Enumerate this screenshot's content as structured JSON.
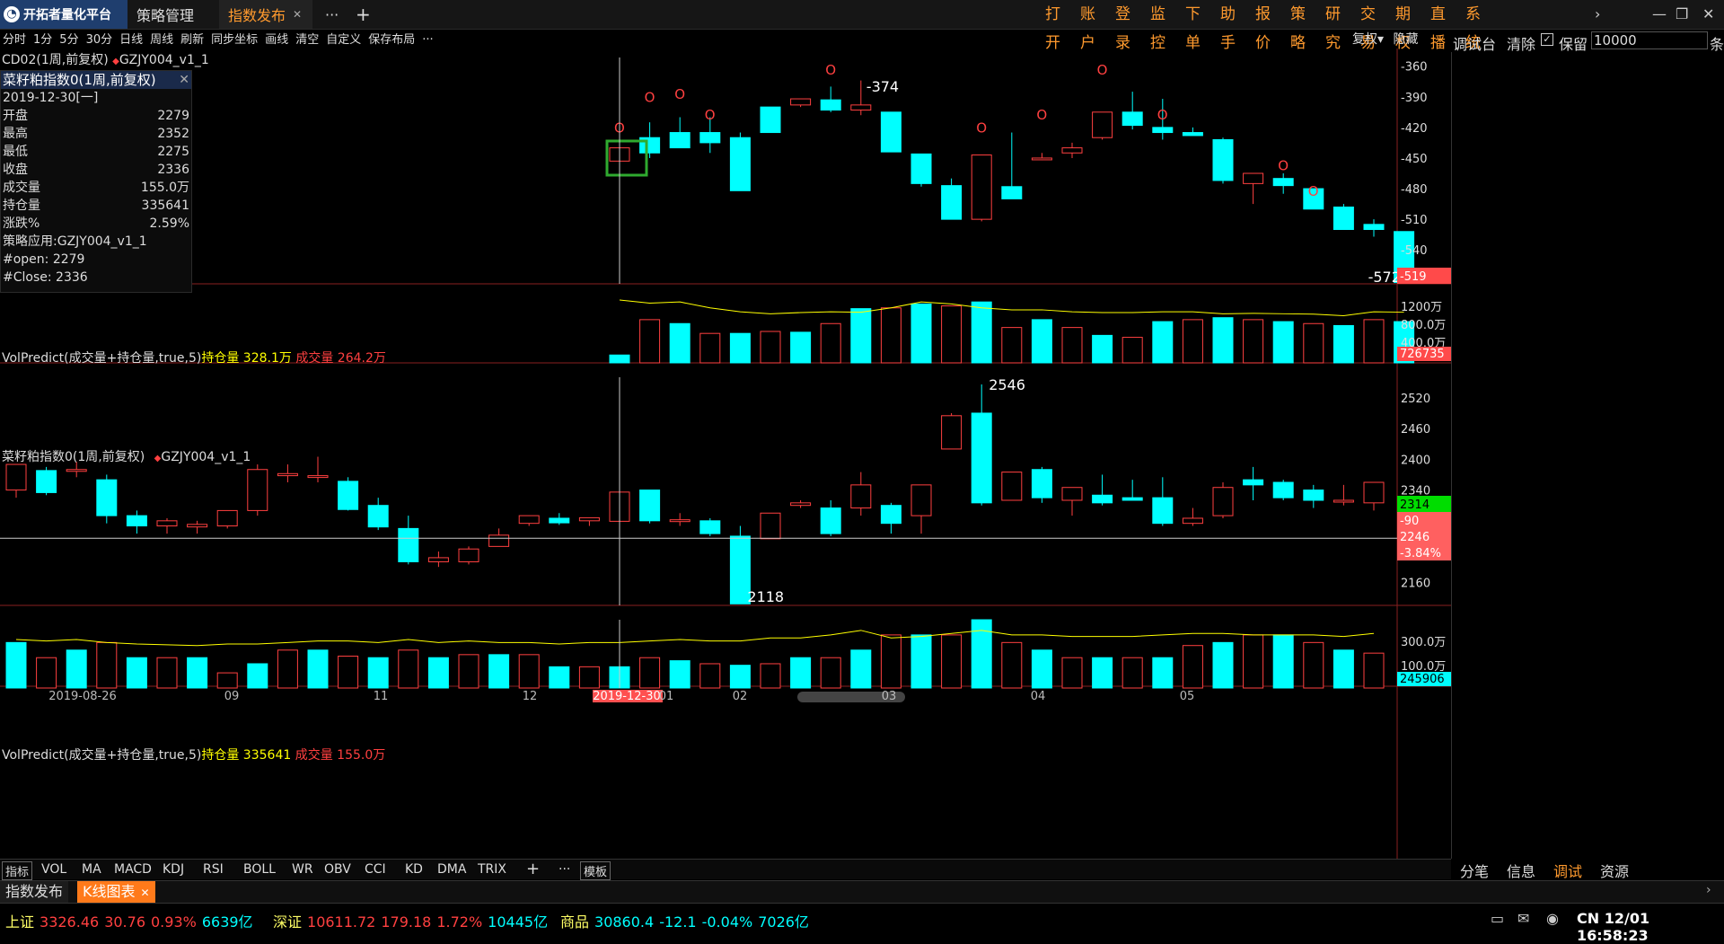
{
  "app": {
    "logo": "开拓者量化平台",
    "tabs": [
      {
        "label": "策略管理"
      },
      {
        "label": "指数发布"
      }
    ],
    "more": "···",
    "add": "+",
    "menus": [
      "打开",
      "账户",
      "登录",
      "监控",
      "下单",
      "助手",
      "报价",
      "策略",
      "研究",
      "交易",
      "期权",
      "直播",
      "系统"
    ]
  },
  "toolbar": {
    "items": [
      "分时",
      "1分",
      "5分",
      "30分",
      "日线",
      "周线",
      "刷新",
      "同步坐标",
      "画线",
      "清空",
      "自定义",
      "保存布局"
    ],
    "more": "···",
    "right": [
      "复权▾",
      "隐藏"
    ]
  },
  "right_toolbar": {
    "debug": "调试台",
    "clear": "清除",
    "keep": "保留",
    "keep_value": "10000",
    "tail": "条"
  },
  "panel1": {
    "header": "CD02(1周,前复权)",
    "strategy": "GZJY004_v1_1",
    "legend_title": "菜籽粕指数0(1周,前复权)",
    "date": "2019-12-30[一]",
    "rows": [
      {
        "k": "开盘",
        "v": "2279"
      },
      {
        "k": "最高",
        "v": "2352"
      },
      {
        "k": "最低",
        "v": "2275"
      },
      {
        "k": "收盘",
        "v": "2336"
      },
      {
        "k": "成交量",
        "v": "155.0万"
      },
      {
        "k": "持仓量",
        "v": "335641"
      },
      {
        "k": "涨跌%",
        "v": "2.59%"
      }
    ],
    "extra": [
      "策略应用:GZJY004_v1_1",
      "#open: 2279",
      "#Close: 2336"
    ],
    "yticks": [
      "-360",
      "-390",
      "-420",
      "-450",
      "-480",
      "-510",
      "-540"
    ],
    "last_badge": "-519",
    "hi_label": "-374",
    "lo_label": "-572"
  },
  "panel2": {
    "title": "VolPredict(成交量+持仓量,true,5)",
    "oi_label": "持仓量 328.1万",
    "vol_label": "成交量 264.2万",
    "yticks": [
      "1200万",
      "800.0万",
      "400.0万"
    ],
    "badge": "726735"
  },
  "panel3": {
    "title": "菜籽粕指数0(1周,前复权)",
    "strategy": "GZJY004_v1_1",
    "yticks": [
      "2520",
      "2460",
      "2400",
      "2340",
      "2160"
    ],
    "badge_price": "2314",
    "badge_chg": "-90",
    "badge_ref": "2246",
    "badge_pct": "-3.84%",
    "hi_label": "2546",
    "lo_label": "2118"
  },
  "panel4": {
    "title": "VolPredict(成交量+持仓量,true,5)",
    "oi_label": "持仓量 335641",
    "vol_label": "成交量 155.0万",
    "yticks": [
      "300.0万",
      "100.0万"
    ],
    "badge": "245906"
  },
  "xaxis": {
    "labels": [
      "2019-08-26",
      "09",
      "11",
      "12",
      "2019-12-30",
      "01",
      "02",
      "03",
      "04",
      "05"
    ]
  },
  "indicator_bar": {
    "label": "指标",
    "items": [
      "VOL",
      "MA",
      "MACD",
      "KDJ",
      "RSI",
      "BOLL",
      "WR",
      "OBV",
      "CCI",
      "KD",
      "DMA",
      "TRIX"
    ],
    "add": "+",
    "more": "···",
    "template": "模板"
  },
  "right_tabs": [
    "分笔",
    "信息",
    "调试",
    "资源"
  ],
  "bottom_tabs": [
    {
      "label": "指数发布"
    },
    {
      "label": "K线图表"
    }
  ],
  "status": {
    "items": [
      {
        "name": "上证",
        "price": "3326.46",
        "chg": "30.76",
        "pct": "0.93%",
        "amt": "6639亿"
      },
      {
        "name": "深证",
        "price": "10611.72",
        "chg": "179.18",
        "pct": "1.72%",
        "amt": "10445亿"
      },
      {
        "name": "商品",
        "price": "30860.4",
        "chg": "-12.1",
        "pct": "-0.04%",
        "amt": "7026亿"
      }
    ],
    "clock": "CN 12/01 16:58:23"
  },
  "colors": {
    "up": "#ff4040",
    "down": "#00ffff",
    "accent": "#ff9a2e",
    "oi": "#ffff00"
  },
  "chart_data": [
    {
      "type": "candlestick",
      "title": "CD02(1周,前复权)",
      "ylim": [
        -575,
        -355
      ],
      "x_start": 20,
      "series": [
        {
          "name": "CD02",
          "ohlc": [
            [
              -453,
              -440,
              -453,
              -440
            ],
            [
              -430,
              -415,
              -450,
              -445
            ],
            [
              -425,
              -410,
              -440,
              -440
            ],
            [
              -425,
              -410,
              -445,
              -435
            ],
            [
              -430,
              -425,
              -482,
              -482
            ],
            [
              -400,
              -400,
              -425,
              -425
            ],
            [
              -398,
              -392,
              -400,
              -392
            ],
            [
              -393,
              -380,
              -405,
              -403
            ],
            [
              -403,
              -374,
              -408,
              -398
            ],
            [
              -405,
              -405,
              -440,
              -444
            ],
            [
              -446,
              -446,
              -478,
              -475
            ],
            [
              -477,
              -470,
              -492,
              -510
            ],
            [
              -510,
              -447,
              -512,
              -447
            ],
            [
              -478,
              -425,
              -490,
              -490
            ],
            [
              -450,
              -445,
              -452,
              -450
            ],
            [
              -445,
              -435,
              -450,
              -440
            ],
            [
              -430,
              -405,
              -432,
              -405
            ],
            [
              -405,
              -385,
              -422,
              -418
            ],
            [
              -420,
              -392,
              -432,
              -425
            ],
            [
              -425,
              -420,
              -428,
              -428
            ],
            [
              -432,
              -430,
              -475,
              -472
            ],
            [
              -475,
              -470,
              -495,
              -465
            ],
            [
              -470,
              -465,
              -485,
              -477
            ],
            [
              -480,
              -480,
              -500,
              -500
            ],
            [
              -498,
              -495,
              -520,
              -520
            ],
            [
              -515,
              -510,
              -527,
              -520
            ],
            [
              -522,
              -522,
              -572,
              -572
            ]
          ]
        }
      ],
      "signals": [
        {
          "i": 0,
          "y": -425
        },
        {
          "i": 1,
          "y": -395
        },
        {
          "i": 2,
          "y": -392
        },
        {
          "i": 3,
          "y": -412
        },
        {
          "i": 7,
          "y": -368
        },
        {
          "i": 12,
          "y": -425
        },
        {
          "i": 14,
          "y": -412
        },
        {
          "i": 16,
          "y": -368
        },
        {
          "i": 18,
          "y": -412
        },
        {
          "i": 22,
          "y": -462
        },
        {
          "i": 23,
          "y": -487
        }
      ]
    },
    {
      "type": "bar",
      "title": "VolPredict(成交量+持仓量,true,5)",
      "ylim": [
        0,
        1600
      ],
      "x_start": 20,
      "values": [
        200,
        1100,
        1000,
        750,
        750,
        800,
        780,
        1000,
        1380,
        1400,
        1500,
        1450,
        1550,
        900,
        1100,
        900,
        700,
        650,
        1050,
        1100,
        1150,
        1100,
        1050,
        1000,
        950,
        1100,
        1050
      ],
      "line": [
        1600,
        1520,
        1550,
        1400,
        1300,
        1250,
        1280,
        1300,
        1290,
        1400,
        1550,
        1500,
        1400,
        1350,
        1350,
        1300,
        1280,
        1280,
        1300,
        1300,
        1250,
        1260,
        1250,
        1240,
        1200,
        1300,
        1290
      ]
    },
    {
      "type": "candlestick",
      "title": "菜籽粕指数0(1周,前复权)",
      "ylim": [
        2115,
        2560
      ],
      "x_start": 0,
      "series": [
        {
          "name": "菜籽粕指数0",
          "ohlc": [
            [
              2340,
              2380,
              2325,
              2390
            ],
            [
              2378,
              2385,
              2330,
              2335
            ],
            [
              2378,
              2395,
              2365,
              2380
            ],
            [
              2360,
              2370,
              2275,
              2290
            ],
            [
              2290,
              2300,
              2255,
              2270
            ],
            [
              2270,
              2285,
              2255,
              2280
            ],
            [
              2268,
              2280,
              2255,
              2273
            ],
            [
              2270,
              2295,
              2265,
              2300
            ],
            [
              2300,
              2390,
              2290,
              2380
            ],
            [
              2368,
              2390,
              2355,
              2372
            ],
            [
              2365,
              2405,
              2355,
              2368
            ],
            [
              2357,
              2365,
              2300,
              2302
            ],
            [
              2310,
              2325,
              2262,
              2268
            ],
            [
              2265,
              2290,
              2195,
              2200
            ],
            [
              2200,
              2220,
              2190,
              2208
            ],
            [
              2200,
              2230,
              2195,
              2225
            ],
            [
              2230,
              2265,
              2230,
              2252
            ],
            [
              2275,
              2290,
              2270,
              2290
            ],
            [
              2285,
              2295,
              2272,
              2276
            ],
            [
              2280,
              2285,
              2270,
              2286
            ],
            [
              2279,
              2352,
              2275,
              2336
            ],
            [
              2340,
              2340,
              2275,
              2280
            ],
            [
              2280,
              2295,
              2270,
              2282
            ],
            [
              2280,
              2285,
              2250,
              2255
            ],
            [
              2250,
              2270,
              2120,
              2118
            ],
            [
              2245,
              2285,
              2245,
              2295
            ],
            [
              2310,
              2320,
              2305,
              2315
            ],
            [
              2305,
              2320,
              2250,
              2255
            ],
            [
              2305,
              2375,
              2290,
              2350
            ],
            [
              2310,
              2315,
              2255,
              2275
            ],
            [
              2290,
              2345,
              2255,
              2350
            ],
            [
              2420,
              2490,
              2420,
              2485
            ],
            [
              2490,
              2546,
              2310,
              2315
            ],
            [
              2320,
              2370,
              2320,
              2375
            ],
            [
              2380,
              2385,
              2315,
              2325
            ],
            [
              2320,
              2345,
              2290,
              2345
            ],
            [
              2330,
              2370,
              2310,
              2315
            ],
            [
              2325,
              2360,
              2320,
              2320
            ],
            [
              2325,
              2365,
              2270,
              2275
            ],
            [
              2275,
              2305,
              2270,
              2285
            ],
            [
              2290,
              2355,
              2285,
              2345
            ],
            [
              2360,
              2385,
              2320,
              2350
            ],
            [
              2355,
              2360,
              2320,
              2325
            ],
            [
              2340,
              2350,
              2305,
              2320
            ],
            [
              2320,
              2350,
              2310,
              2320
            ],
            [
              2315,
              2355,
              2300,
              2355
            ]
          ]
        }
      ]
    },
    {
      "type": "bar",
      "title": "VolPredict(成交量+持仓量,true,5)",
      "ylim": [
        0,
        450
      ],
      "x_start": 0,
      "values": [
        300,
        200,
        250,
        300,
        200,
        200,
        200,
        100,
        160,
        250,
        250,
        210,
        200,
        250,
        200,
        220,
        220,
        220,
        140,
        140,
        140,
        200,
        180,
        160,
        150,
        160,
        200,
        200,
        250,
        350,
        350,
        350,
        450,
        300,
        250,
        200,
        200,
        200,
        200,
        280,
        300,
        350,
        350,
        300,
        250,
        230
      ],
      "line": [
        320,
        310,
        320,
        300,
        290,
        285,
        280,
        290,
        290,
        300,
        310,
        310,
        300,
        320,
        300,
        310,
        300,
        300,
        290,
        300,
        300,
        310,
        320,
        310,
        310,
        330,
        330,
        350,
        380,
        330,
        340,
        360,
        380,
        350,
        350,
        340,
        340,
        340,
        350,
        360,
        360,
        350,
        350,
        350,
        340,
        360
      ]
    }
  ]
}
